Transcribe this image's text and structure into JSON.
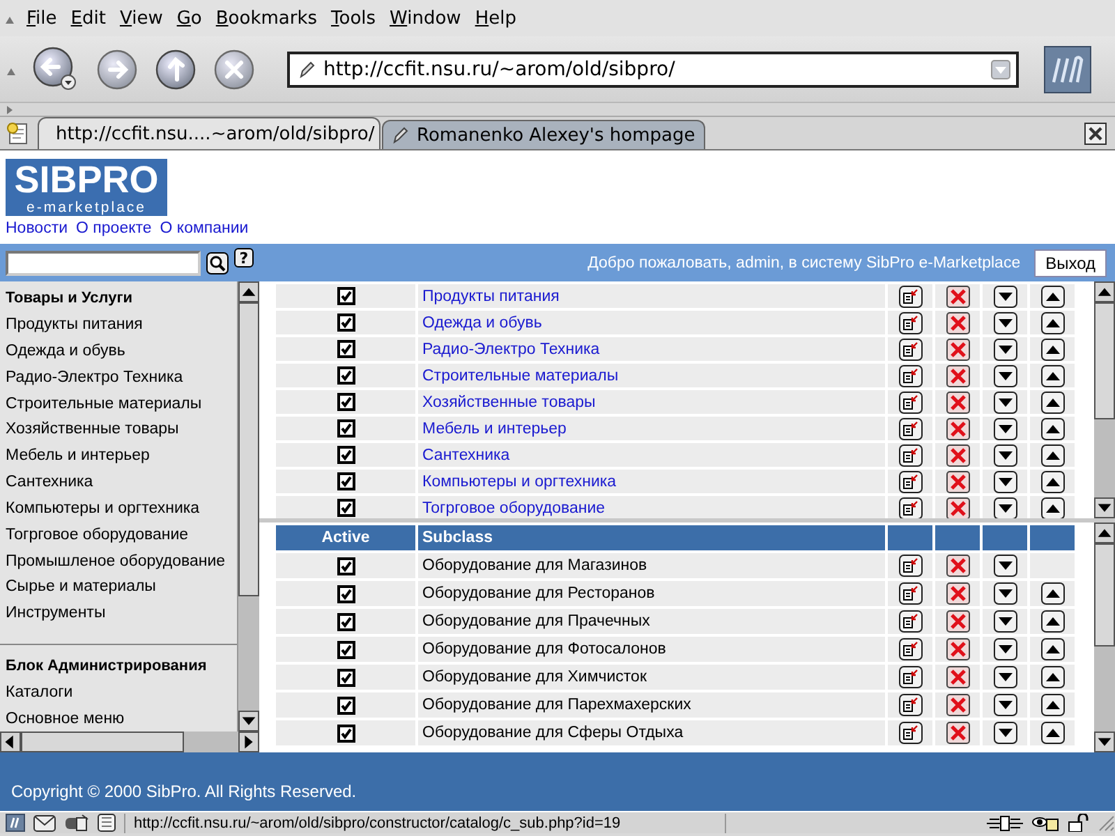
{
  "menu": [
    "File",
    "Edit",
    "View",
    "Go",
    "Bookmarks",
    "Tools",
    "Window",
    "Help"
  ],
  "address": {
    "url": "http://ccfit.nsu.ru/~arom/old/sibpro/"
  },
  "tabs": [
    {
      "label": "http://ccfit.nsu....~arom/old/sibpro/",
      "selected": true
    },
    {
      "label": "Romanenko Alexey's hompage",
      "selected": false
    }
  ],
  "site": {
    "logo_title": "SIBPRO",
    "logo_subtitle": "e-marketplace",
    "nav": [
      "Новости",
      "О проекте",
      "О компании"
    ],
    "help_label": "?",
    "welcome": "Добро пожаловать, admin, в систему SibPro e-Marketplace",
    "logout": "Выход"
  },
  "sidebar": {
    "sections": [
      {
        "title": "Товары и Услуги",
        "items": [
          "Продукты питания",
          "Одежда и обувь",
          "Радио-Электро Техника",
          "Строительные материалы",
          "Хозяйственные товары",
          "Мебель и интерьер",
          "Сантехника",
          "Компьютеры и оргтехника",
          "Тогрговое оборудование",
          "Промышленое оборудование",
          "Сырье и материалы",
          "Инструменты"
        ]
      },
      {
        "title": "Блок Администрирования",
        "items": [
          "Каталоги",
          "Основное меню"
        ]
      }
    ]
  },
  "classes": {
    "kind": "links",
    "rows": [
      {
        "name": "Продукты питания",
        "active": true,
        "can_move_up": true
      },
      {
        "name": "Одежда и обувь",
        "active": true,
        "can_move_up": true
      },
      {
        "name": "Радио-Электро Техника",
        "active": true,
        "can_move_up": true
      },
      {
        "name": "Строительные материалы",
        "active": true,
        "can_move_up": true
      },
      {
        "name": "Хозяйственные товары",
        "active": true,
        "can_move_up": true
      },
      {
        "name": "Мебель и интерьер",
        "active": true,
        "can_move_up": true
      },
      {
        "name": "Сантехника",
        "active": true,
        "can_move_up": true
      },
      {
        "name": "Компьютеры и оргтехника",
        "active": true,
        "can_move_up": true
      },
      {
        "name": "Тогрговое оборудование",
        "active": true,
        "can_move_up": true
      }
    ]
  },
  "subclasses": {
    "kind": "plain",
    "columns": [
      "Active",
      "Subclass"
    ],
    "rows": [
      {
        "name": "Оборудование для Магазинов",
        "active": true,
        "can_move_up": false
      },
      {
        "name": "Оборудование для Ресторанов",
        "active": true,
        "can_move_up": true
      },
      {
        "name": "Оборудование для Прачечных",
        "active": true,
        "can_move_up": true
      },
      {
        "name": "Оборудование для Фотосалонов",
        "active": true,
        "can_move_up": true
      },
      {
        "name": "Оборудование для Химчисток",
        "active": true,
        "can_move_up": true
      },
      {
        "name": "Оборудование для Парехмахерских",
        "active": true,
        "can_move_up": true
      },
      {
        "name": "Оборудование для Сферы Отдыха",
        "active": true,
        "can_move_up": true
      }
    ]
  },
  "footer": "Copyright © 2000 SibPro. All Rights Reserved.",
  "status_bar": {
    "url": "http://ccfit.nsu.ru/~arom/old/sibpro/constructor/catalog/c_sub.php?id=19"
  }
}
